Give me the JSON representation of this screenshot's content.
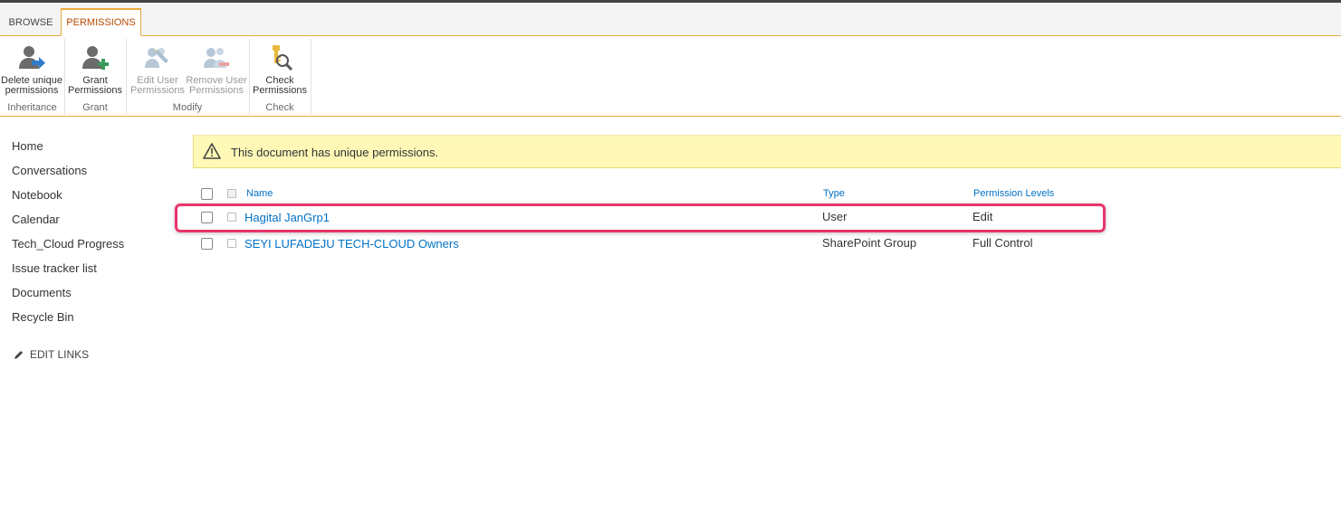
{
  "tabs": [
    {
      "label": "BROWSE"
    },
    {
      "label": "PERMISSIONS"
    }
  ],
  "ribbon": {
    "groups": [
      {
        "name": "Inheritance",
        "buttons": [
          {
            "line1": "Delete unique",
            "line2": "permissions",
            "icon": "delete-unique-permissions-icon"
          }
        ]
      },
      {
        "name": "Grant",
        "buttons": [
          {
            "line1": "Grant",
            "line2": "Permissions",
            "icon": "grant-permissions-icon"
          }
        ]
      },
      {
        "name": "Modify",
        "buttons": [
          {
            "line1": "Edit User",
            "line2": "Permissions",
            "icon": "edit-user-permissions-icon"
          },
          {
            "line1": "Remove User",
            "line2": "Permissions",
            "icon": "remove-user-permissions-icon"
          }
        ]
      },
      {
        "name": "Check",
        "buttons": [
          {
            "line1": "Check",
            "line2": "Permissions",
            "icon": "check-permissions-icon"
          }
        ]
      }
    ]
  },
  "nav": {
    "items": [
      "Home",
      "Conversations",
      "Notebook",
      "Calendar",
      "Tech_Cloud Progress",
      "Issue tracker list",
      "Documents",
      "Recycle Bin"
    ],
    "edit_links": "EDIT LINKS"
  },
  "banner": {
    "message": "This document has unique permissions."
  },
  "table": {
    "headers": {
      "name": "Name",
      "type": "Type",
      "permission": "Permission Levels"
    },
    "rows": [
      {
        "name": "Hagital JanGrp1",
        "type": "User",
        "permission": "Edit"
      },
      {
        "name": "SEYI LUFADEJU TECH-CLOUD Owners",
        "type": "SharePoint Group",
        "permission": "Full Control"
      }
    ]
  },
  "colors": {
    "accent": "#e8a93b",
    "link": "#0072c6",
    "highlight": "#e8346a",
    "banner": "#fff8b7"
  }
}
